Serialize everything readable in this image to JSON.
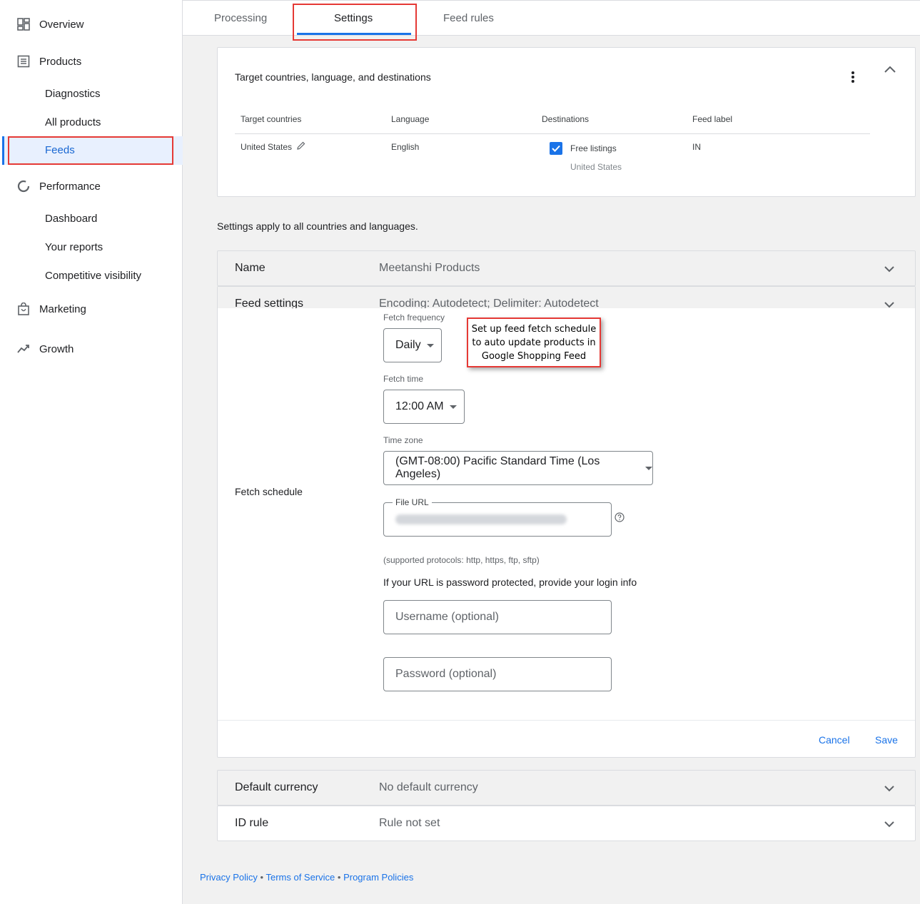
{
  "sidebar": {
    "overview": "Overview",
    "products": "Products",
    "diagnostics": "Diagnostics",
    "all_products": "All products",
    "feeds": "Feeds",
    "performance": "Performance",
    "dashboard": "Dashboard",
    "your_reports": "Your reports",
    "competitive_visibility": "Competitive visibility",
    "marketing": "Marketing",
    "growth": "Growth"
  },
  "tabs": {
    "processing": "Processing",
    "settings": "Settings",
    "feed_rules": "Feed rules"
  },
  "target_card": {
    "title": "Target countries, language, and destinations",
    "headers": {
      "countries": "Target countries",
      "language": "Language",
      "destinations": "Destinations",
      "feed_label": "Feed label"
    },
    "row": {
      "country": "United States",
      "language": "English",
      "destination": "Free listings",
      "destination_sub": "United States",
      "feed_label": "IN"
    }
  },
  "settings_note": "Settings apply to all countries and languages.",
  "name_row": {
    "label": "Name",
    "value": "Meetanshi Products"
  },
  "feed_settings": {
    "label": "Feed settings",
    "value": "Encoding: Autodetect; Delimiter: Autodetect",
    "fetch_schedule_label": "Fetch schedule",
    "fetch_frequency_label": "Fetch frequency",
    "fetch_frequency_value": "Daily",
    "fetch_time_label": "Fetch time",
    "fetch_time_value": "12:00 AM",
    "time_zone_label": "Time zone",
    "time_zone_value": "(GMT-08:00) Pacific Standard Time (Los Angeles)",
    "file_url_label": "File URL",
    "protocols_note": "(supported protocols: http, https, ftp, sftp)",
    "password_note": "If your URL is password protected, provide your login info",
    "username_placeholder": "Username (optional)",
    "password_placeholder": "Password (optional)",
    "cancel": "Cancel",
    "save": "Save"
  },
  "callout": {
    "line1": "Set up feed fetch schedule",
    "line2": "to auto update products in",
    "line3": "Google Shopping Feed"
  },
  "default_currency": {
    "label": "Default currency",
    "value": "No default currency"
  },
  "id_rule": {
    "label": "ID rule",
    "value": "Rule not set"
  },
  "footer": {
    "privacy": "Privacy Policy",
    "sep": " • ",
    "terms": "Terms of Service",
    "program": "Program Policies"
  },
  "colors": {
    "accent": "#1a73e8",
    "highlight": "#e53935"
  }
}
